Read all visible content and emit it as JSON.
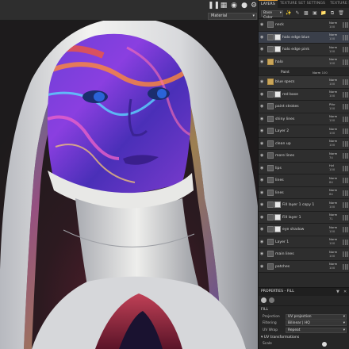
{
  "toolbar": {
    "icons": [
      "pause-icon",
      "grid-layout-icon",
      "camera-icon",
      "sphere-icon",
      "camera-settings-icon",
      "layers-icon"
    ],
    "material_select": "Material"
  },
  "panel": {
    "tabs": [
      "LAYERS",
      "TEXTURE SET SETTINGS",
      "TEXTURE SET LIST"
    ],
    "channel_select": "Base Color",
    "layers": [
      {
        "name": "neck",
        "op": "Norm",
        "val": "100",
        "kind": "paint",
        "visible": true
      },
      {
        "name": "halo edge blue",
        "op": "Norm",
        "val": "100",
        "kind": "mask",
        "selected": true,
        "visible": true
      },
      {
        "name": "halo edge pink",
        "op": "Norm",
        "val": "100",
        "kind": "mask",
        "visible": true
      },
      {
        "name": "halo",
        "op": "Norm",
        "val": "100",
        "kind": "folder",
        "visible": true
      },
      {
        "name": "Paint",
        "op": "Norm",
        "val": "100",
        "kind": "sub",
        "visible": true
      },
      {
        "name": "blue specs",
        "op": "Norm",
        "val": "100",
        "kind": "folder",
        "visible": true
      },
      {
        "name": "red base",
        "op": "Norm",
        "val": "100",
        "kind": "mask",
        "visible": true
      },
      {
        "name": "paint strokes",
        "op": "Pthr",
        "val": "100",
        "kind": "paint",
        "visible": true
      },
      {
        "name": "shiny lines",
        "op": "Norm",
        "val": "100",
        "kind": "paint",
        "visible": true
      },
      {
        "name": "Layer 2",
        "op": "Norm",
        "val": "100",
        "kind": "paint",
        "visible": true
      },
      {
        "name": "clean up",
        "op": "Norm",
        "val": "100",
        "kind": "paint",
        "visible": true
      },
      {
        "name": "more lines",
        "op": "Norm",
        "val": "74",
        "kind": "paint",
        "visible": true
      },
      {
        "name": "lips",
        "op": "HzI",
        "val": "100",
        "kind": "paint",
        "visible": true
      },
      {
        "name": "lines",
        "op": "Norm",
        "val": "84",
        "kind": "paint",
        "visible": true
      },
      {
        "name": "lines",
        "op": "Norm",
        "val": "84",
        "kind": "paint",
        "visible": true
      },
      {
        "name": "Fill layer 1 copy 1",
        "op": "Norm",
        "val": "100",
        "kind": "fill",
        "visible": true
      },
      {
        "name": "Fill layer 1",
        "op": "Norm",
        "val": "71",
        "kind": "fill",
        "visible": true
      },
      {
        "name": "eye shadow",
        "op": "Norm",
        "val": "100",
        "kind": "mask",
        "visible": true
      },
      {
        "name": "Layer 1",
        "op": "Norm",
        "val": "100",
        "kind": "paint",
        "visible": true
      },
      {
        "name": "main lines",
        "op": "Norm",
        "val": "100",
        "kind": "paint",
        "visible": true
      },
      {
        "name": "patches",
        "op": "Norm",
        "val": "100",
        "kind": "paint",
        "visible": true
      }
    ]
  },
  "props": {
    "header": "PROPERTIES - FILL",
    "section": "FILL",
    "rows": [
      {
        "label": "Projection",
        "value": "UV projection"
      },
      {
        "label": "Filtering",
        "value": "Bilinear | HQ"
      },
      {
        "label": "UV Wrap",
        "value": "Repeat"
      }
    ],
    "uv_section": "UV transformations",
    "uv_extra_label": "Scale"
  },
  "colors": {
    "accent": "#e8a33a",
    "selected": "#3a3f4a"
  }
}
